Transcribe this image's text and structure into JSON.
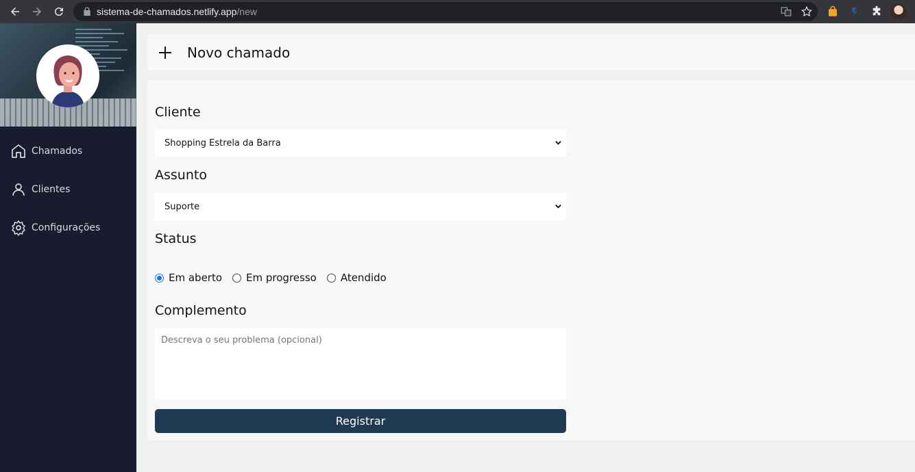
{
  "browser": {
    "url_domain": "sistema-de-chamados.netlify.app",
    "url_path": "/new"
  },
  "sidebar": {
    "items": [
      {
        "label": "Chamados",
        "icon": "home-icon"
      },
      {
        "label": "Clientes",
        "icon": "user-icon"
      },
      {
        "label": "Configurações",
        "icon": "gear-icon"
      }
    ]
  },
  "header": {
    "title": "Novo chamado",
    "icon": "plus-icon"
  },
  "form": {
    "cliente_label": "Cliente",
    "cliente_value": "Shopping Estrela da Barra",
    "assunto_label": "Assunto",
    "assunto_value": "Suporte",
    "status_label": "Status",
    "status_options": [
      {
        "label": "Em aberto",
        "checked": true
      },
      {
        "label": "Em progresso",
        "checked": false
      },
      {
        "label": "Atendido",
        "checked": false
      }
    ],
    "complemento_label": "Complemento",
    "complemento_placeholder": "Descreva o seu problema (opcional)",
    "submit_label": "Registrar"
  },
  "colors": {
    "sidebar_bg": "#181c2e",
    "button_bg": "#1f3a52",
    "radio_checked": "#1a73e8"
  }
}
